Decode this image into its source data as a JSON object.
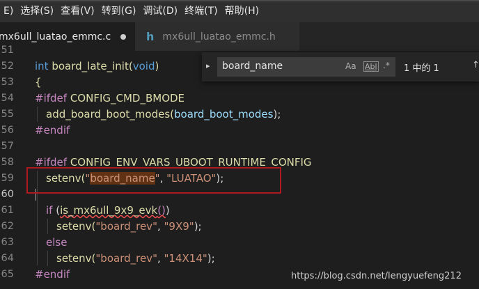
{
  "menu": [
    "E)",
    "选择(S)",
    "查看(V)",
    "转到(G)",
    "调试(D)",
    "终端(T)",
    "帮助(H)"
  ],
  "tabs": {
    "active": "mx6ull_luatao_emmc.c",
    "inactive": "mx6ull_luatao_emmc.h",
    "inactive_icon": "h"
  },
  "find": {
    "value": "board_name",
    "opt_case": "Aa",
    "opt_word": "Abl",
    "opt_regex": ".*",
    "count": "1 中的 1"
  },
  "lines": {
    "l51": "51",
    "l52": "52",
    "l53": "53",
    "l54": "54",
    "l55": "55",
    "l56": "56",
    "l57": "57",
    "l58": "58",
    "l59": "59",
    "l60": "60",
    "l61": "61",
    "l62": "62",
    "l63": "63",
    "l64": "64",
    "l65": "65"
  },
  "code": {
    "c52_kw": "int",
    "c52_fn": "board_late_init",
    "c52_paren_open": "(",
    "c52_void": "void",
    "c52_paren_close": ")",
    "c53": "{",
    "c54_pp": "#ifdef",
    "c54_rest": " CONFIG_CMD_BMODE",
    "c55_fn": "add_board_boot_modes",
    "c55_open": "(",
    "c55_arg": "board_boot_modes",
    "c55_close": ");",
    "c56": "#endif",
    "c58_pp": "#ifdef",
    "c58_rest": " CONFIG_ENV_VARS_UBOOT_RUNTIME_CONFIG",
    "c59_fn": "setenv",
    "c59_open": "(",
    "c59_q1": "\"",
    "c59_match": "board_name",
    "c59_q2": "\"",
    "c59_comma": ", ",
    "c59_str2": "\"LUATAO\"",
    "c59_close": ");",
    "c61_kw": "if",
    "c61_open": " (",
    "c61_fn": "is_mx6ull_9x9_evk",
    "c61_call": "()",
    "c61_close": ")",
    "c62_fn": "setenv",
    "c62_open": "(",
    "c62_str1": "\"board_rev\"",
    "c62_comma": ", ",
    "c62_str2": "\"9X9\"",
    "c62_close": ");",
    "c63_kw": "else",
    "c64_fn": "setenv",
    "c64_open": "(",
    "c64_str1": "\"board_rev\"",
    "c64_comma": ", ",
    "c64_str2": "\"14X14\"",
    "c64_close": ");",
    "c65": "#endif"
  },
  "watermark": "https://blog.csdn.net/lengyuefeng212"
}
